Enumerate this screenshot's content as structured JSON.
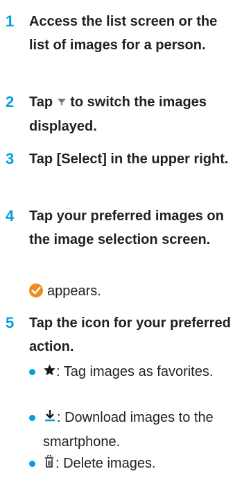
{
  "steps": [
    {
      "number": "1",
      "text": "Access the list screen or the list of images for a person."
    },
    {
      "number": "2",
      "text_before": "Tap",
      "filter_icon": "filter-icon",
      "text_after": "to switch the images displayed."
    },
    {
      "number": "3",
      "text": "Tap [Select] in the upper right."
    },
    {
      "number": "4",
      "text": "Tap your preferred images on the image selection screen.",
      "note_icon": "check-icon",
      "note_text": "appears."
    },
    {
      "number": "5",
      "text": "Tap the icon for your preferred action."
    }
  ],
  "actions": [
    {
      "icon": "star-icon",
      "text": ": Tag images as favorites."
    },
    {
      "icon": "download-icon",
      "text": ": Download images to the smartphone."
    },
    {
      "icon": "trash-icon",
      "text": ": Delete images."
    }
  ],
  "colors": {
    "accent": "#00a0e0",
    "check": "#f08c1e",
    "text": "#231f20"
  }
}
